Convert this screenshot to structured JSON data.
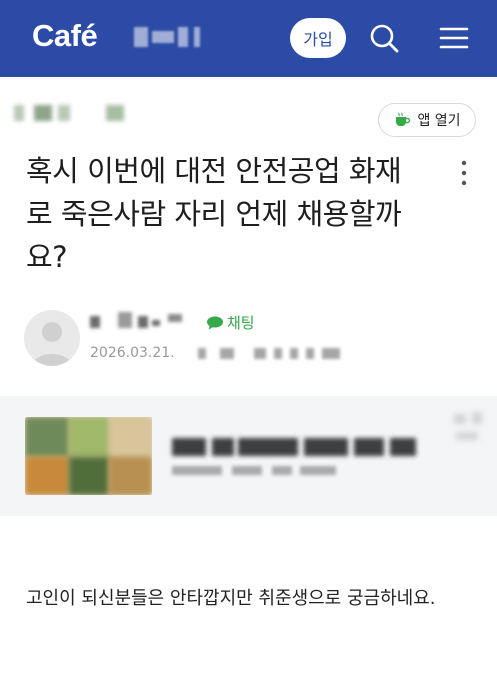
{
  "header": {
    "logo": "Café",
    "join_label": "가입",
    "icons": [
      "search-icon",
      "menu-icon"
    ],
    "bg_color": "#2c4ba6"
  },
  "toolbar": {
    "app_open_label": "앱 열기",
    "app_icon": "coffee-cup-icon",
    "app_icon_color": "#35a84a"
  },
  "post": {
    "title": "혹시 이번에 대전 안전공업 화재로 죽은사람 자리 언제 채용할까요?",
    "chat_label": "채팅",
    "date": "2026.03.21.",
    "body": "고인이 되신분들은 안타깝지만 취준생으로 궁금하네요."
  },
  "colors": {
    "accent_green": "#35a84a",
    "header_blue": "#2c4ba6",
    "related_bg": "#f4f5f7"
  }
}
